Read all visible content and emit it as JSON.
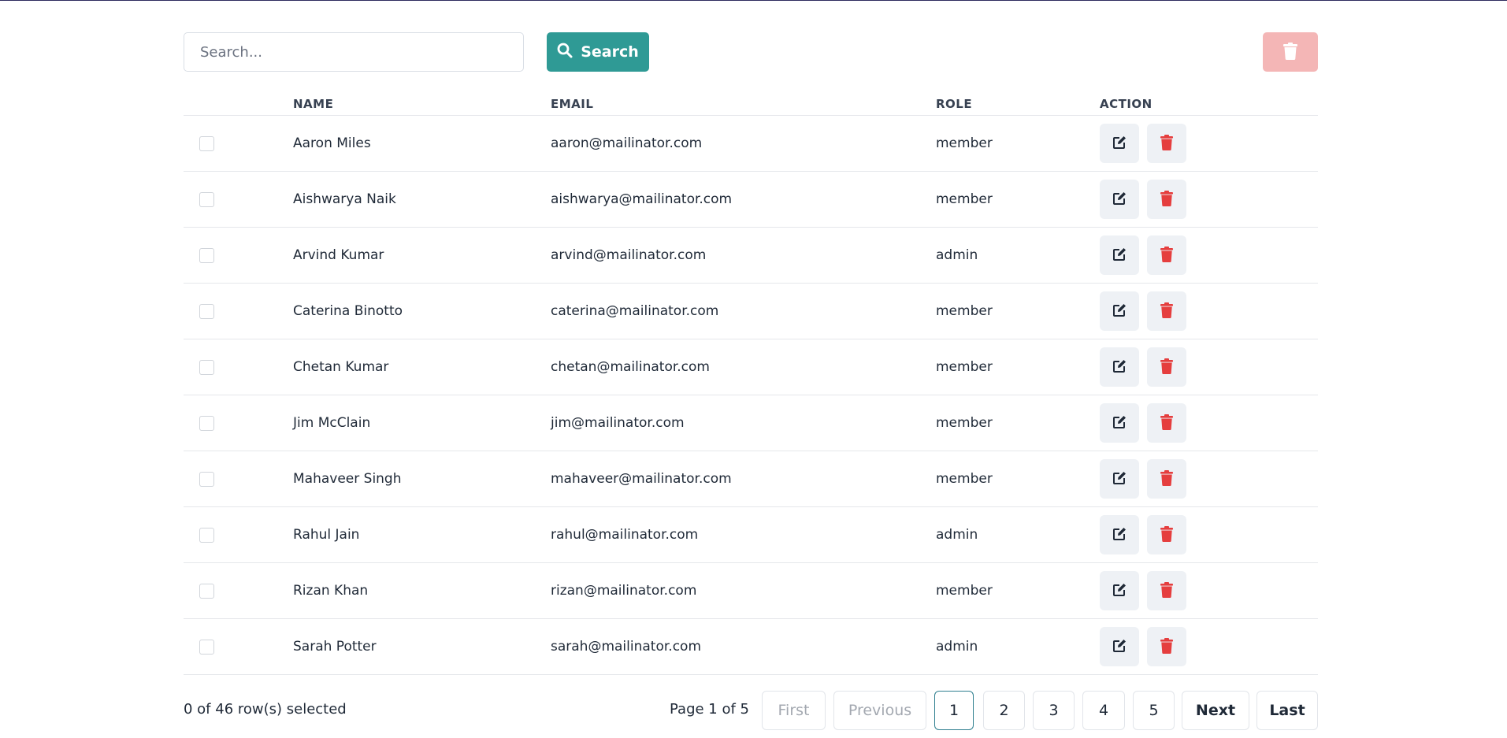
{
  "search": {
    "placeholder": "Search...",
    "value": "",
    "button_label": "Search"
  },
  "table": {
    "headers": {
      "name": "NAME",
      "email": "EMAIL",
      "role": "ROLE",
      "action": "ACTION"
    },
    "rows": [
      {
        "name": "Aaron Miles",
        "email": "aaron@mailinator.com",
        "role": "member"
      },
      {
        "name": "Aishwarya Naik",
        "email": "aishwarya@mailinator.com",
        "role": "member"
      },
      {
        "name": "Arvind Kumar",
        "email": "arvind@mailinator.com",
        "role": "admin"
      },
      {
        "name": "Caterina Binotto",
        "email": "caterina@mailinator.com",
        "role": "member"
      },
      {
        "name": "Chetan Kumar",
        "email": "chetan@mailinator.com",
        "role": "member"
      },
      {
        "name": "Jim McClain",
        "email": "jim@mailinator.com",
        "role": "member"
      },
      {
        "name": "Mahaveer Singh",
        "email": "mahaveer@mailinator.com",
        "role": "member"
      },
      {
        "name": "Rahul Jain",
        "email": "rahul@mailinator.com",
        "role": "admin"
      },
      {
        "name": "Rizan Khan",
        "email": "rizan@mailinator.com",
        "role": "member"
      },
      {
        "name": "Sarah Potter",
        "email": "sarah@mailinator.com",
        "role": "admin"
      }
    ]
  },
  "footer": {
    "selected_text": "0 of 46 row(s) selected",
    "page_info": "Page 1 of 5",
    "first_label": "First",
    "previous_label": "Previous",
    "pages": [
      "1",
      "2",
      "3",
      "4",
      "5"
    ],
    "current_page": "1",
    "next_label": "Next",
    "last_label": "Last"
  },
  "icons": {
    "search": "search-icon",
    "bulk_delete": "trash-icon",
    "edit": "edit-icon",
    "delete": "trash-icon"
  },
  "colors": {
    "primary": "#2f9a95",
    "danger": "#e53e3e",
    "danger_disabled": "#f4b6b6",
    "action_bg": "#eef1f5"
  }
}
